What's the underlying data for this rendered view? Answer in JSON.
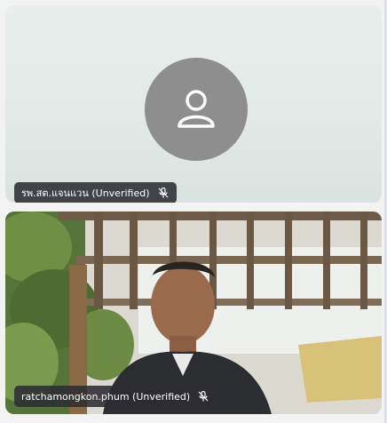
{
  "participants": [
    {
      "display_name": "รพ.สต.แจนแวน (Unverified)",
      "avatar_icon": "person-icon",
      "mic_icon": "mic-off-icon",
      "video_on": false
    },
    {
      "display_name": "ratchamongkon.phum (Unverified)",
      "mic_icon": "mic-off-icon",
      "video_on": true
    }
  ],
  "colors": {
    "avatar_bg": "#8e8e8e",
    "chip_bg": "#2c2c32",
    "chip_text": "#ffffff"
  }
}
